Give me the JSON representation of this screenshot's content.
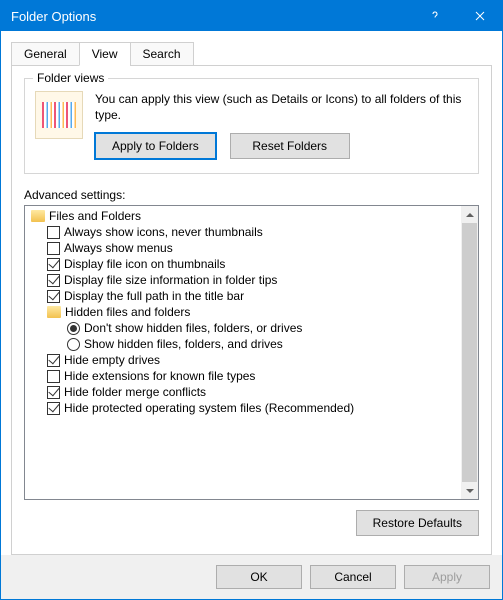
{
  "window": {
    "title": "Folder Options"
  },
  "tabs": {
    "general": "General",
    "view": "View",
    "search": "Search"
  },
  "folderViews": {
    "legend": "Folder views",
    "desc": "You can apply this view (such as Details or Icons) to all folders of this type.",
    "applyBtn": "Apply to Folders",
    "resetBtn": "Reset Folders"
  },
  "advanced": {
    "label": "Advanced settings:",
    "rootLabel": "Files and Folders",
    "items": [
      {
        "type": "check",
        "checked": false,
        "label": "Always show icons, never thumbnails"
      },
      {
        "type": "check",
        "checked": false,
        "label": "Always show menus"
      },
      {
        "type": "check",
        "checked": true,
        "label": "Display file icon on thumbnails"
      },
      {
        "type": "check",
        "checked": true,
        "label": "Display file size information in folder tips"
      },
      {
        "type": "check",
        "checked": true,
        "label": "Display the full path in the title bar"
      },
      {
        "type": "group",
        "label": "Hidden files and folders"
      },
      {
        "type": "radio",
        "checked": true,
        "label": "Don't show hidden files, folders, or drives"
      },
      {
        "type": "radio",
        "checked": false,
        "label": "Show hidden files, folders, and drives"
      },
      {
        "type": "check",
        "checked": true,
        "label": "Hide empty drives"
      },
      {
        "type": "check",
        "checked": false,
        "label": "Hide extensions for known file types"
      },
      {
        "type": "check",
        "checked": true,
        "label": "Hide folder merge conflicts"
      },
      {
        "type": "check",
        "checked": true,
        "label": "Hide protected operating system files (Recommended)"
      }
    ],
    "restoreBtn": "Restore Defaults"
  },
  "footer": {
    "ok": "OK",
    "cancel": "Cancel",
    "apply": "Apply"
  }
}
